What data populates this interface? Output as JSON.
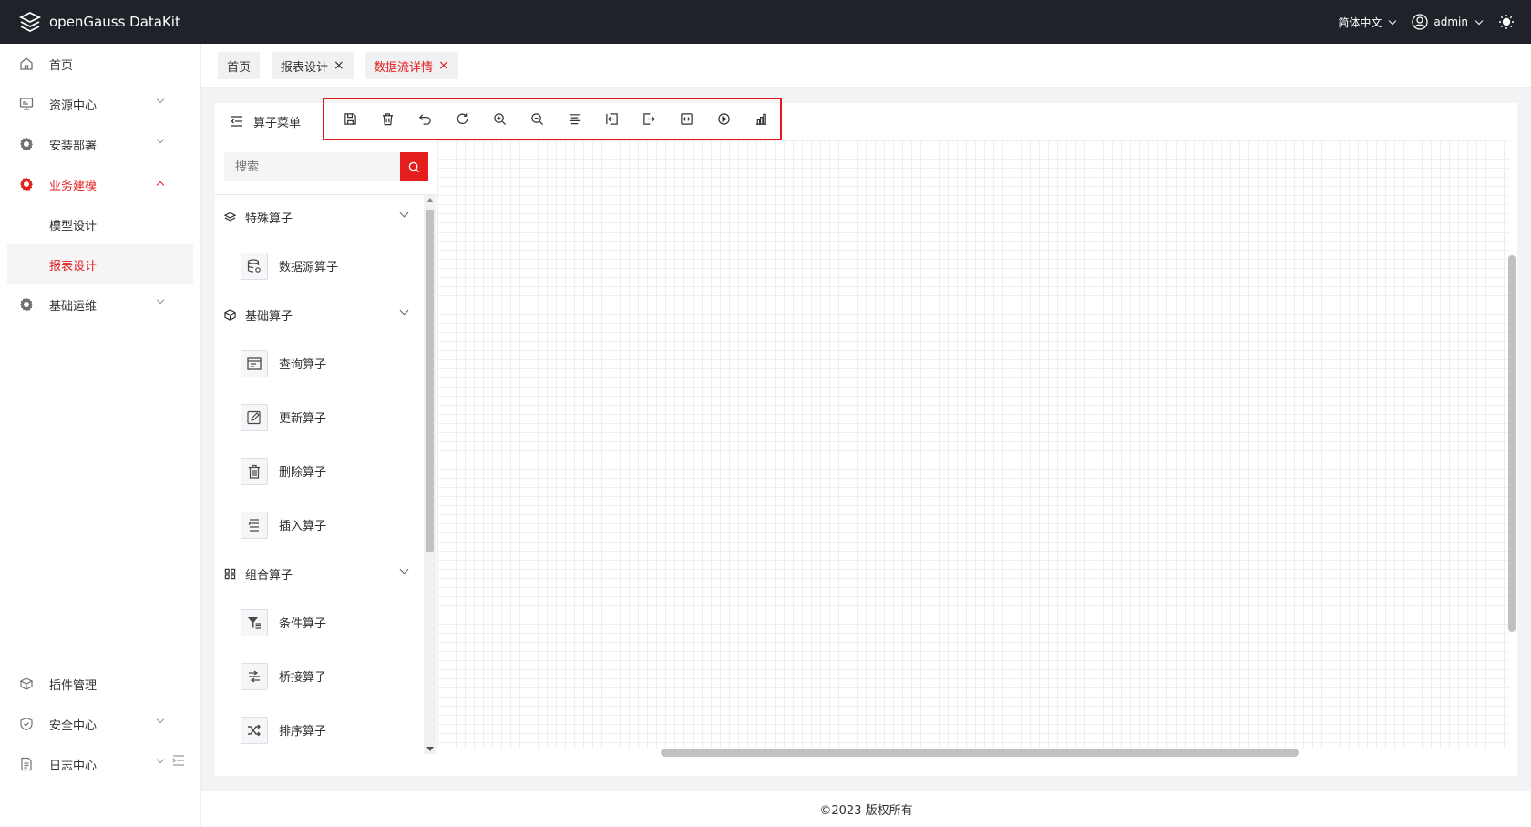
{
  "app": {
    "title": "openGauss DataKit"
  },
  "header": {
    "language": "简体中文",
    "user": "admin"
  },
  "sidebar": {
    "items": [
      {
        "label": "首页",
        "icon": "home-icon"
      },
      {
        "label": "资源中心",
        "icon": "monitor-icon"
      },
      {
        "label": "安装部署",
        "icon": "gear-icon"
      },
      {
        "label": "业务建模",
        "icon": "gear-icon",
        "expanded": true,
        "children": [
          {
            "label": "模型设计"
          },
          {
            "label": "报表设计",
            "selected": true
          }
        ]
      },
      {
        "label": "基础运维",
        "icon": "gear-icon"
      }
    ],
    "bottom_items": [
      {
        "label": "插件管理",
        "icon": "plugin-icon"
      },
      {
        "label": "安全中心",
        "icon": "shield-icon"
      },
      {
        "label": "日志中心",
        "icon": "document-icon"
      }
    ]
  },
  "tabs": [
    {
      "label": "首页"
    },
    {
      "label": "报表设计",
      "closable": true
    },
    {
      "label": "数据流详情",
      "closable": true,
      "active": true
    }
  ],
  "operator_menu": {
    "title": "算子菜单",
    "search_placeholder": "搜索",
    "groups": [
      {
        "label": "特殊算子",
        "icon": "layers-icon",
        "items": [
          {
            "label": "数据源算子",
            "icon": "database-icon"
          }
        ]
      },
      {
        "label": "基础算子",
        "icon": "cube-icon",
        "items": [
          {
            "label": "查询算子",
            "icon": "query-icon"
          },
          {
            "label": "更新算子",
            "icon": "edit-icon"
          },
          {
            "label": "删除算子",
            "icon": "trash-icon"
          },
          {
            "label": "插入算子",
            "icon": "insert-icon"
          }
        ]
      },
      {
        "label": "组合算子",
        "icon": "grid-icon",
        "items": [
          {
            "label": "条件算子",
            "icon": "filter-icon"
          },
          {
            "label": "桥接算子",
            "icon": "bridge-icon"
          },
          {
            "label": "排序算子",
            "icon": "shuffle-icon"
          }
        ]
      }
    ]
  },
  "toolbar": {
    "tools": [
      "save-icon",
      "delete-icon",
      "undo-icon",
      "redo-icon",
      "zoom-in-icon",
      "zoom-out-icon",
      "align-center-icon",
      "import-icon",
      "export-icon",
      "code-icon",
      "run-icon",
      "chart-icon"
    ],
    "highlight_color": "#e8151b"
  },
  "footer": {
    "copyright": "©2023 版权所有"
  },
  "colors": {
    "accent": "#e41d1d",
    "topbar": "#1f2329"
  }
}
